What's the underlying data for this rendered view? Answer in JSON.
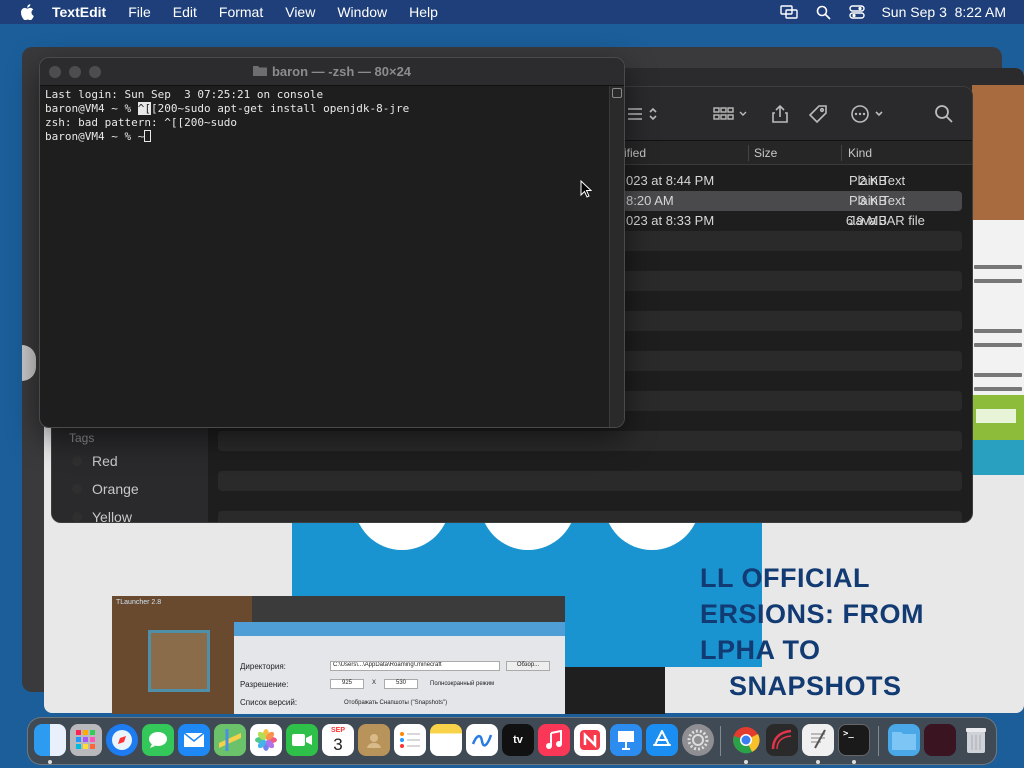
{
  "menubar": {
    "app_name": "TextEdit",
    "items": [
      "File",
      "Edit",
      "Format",
      "View",
      "Window",
      "Help"
    ],
    "clock": "Sun Sep 3  8:22 AM"
  },
  "terminal": {
    "title": "baron — -zsh — 80×24",
    "line1": "Last login: Sun Sep  3 07:25:21 on console",
    "line2_prompt": "baron@VM4 ~ % ",
    "line2_highlight": "^[",
    "line2_rest": "[200~sudo apt-get install openjdk-8-jre",
    "line3": "zsh: bad pattern: ^[[200~sudo",
    "line4_prompt": "baron@VM4 ~ % ~"
  },
  "finder": {
    "columns": {
      "modified": "ified",
      "size": "Size",
      "kind": "Kind"
    },
    "rows": [
      {
        "modified": "023 at 8:44 PM",
        "size": "2 KB",
        "kind": "Plain Text"
      },
      {
        "modified": "8:20 AM",
        "size": "3 KB",
        "kind": "Plain Text"
      },
      {
        "modified": "023 at 8:33 PM",
        "size": "6.9 MB",
        "kind": "Java JAR file"
      }
    ],
    "tags_title": "Tags",
    "tags": [
      "Red",
      "Orange",
      "Yellow"
    ]
  },
  "web": {
    "promo_lines": [
      "LL OFFICIAL",
      "ERSIONS: FROM",
      "LPHA TO",
      "SNAPSHOTS"
    ],
    "launcher": {
      "title": "TLauncher 2.8",
      "dir_label": "Директория:",
      "dir_value": "C:\\Users\\...\\AppData\\Roaming\\.minecraft",
      "browse": "Обзор...",
      "res_label": "Разрешение:",
      "res_w": "925",
      "res_x": "X",
      "res_h": "530",
      "fullscreen": "Полноэкранный режим",
      "versions_label": "Список версий:",
      "snapshots": "Отображать Снапшоты (\"Snapshots\")"
    }
  },
  "dock": {
    "calendar_month": "SEP",
    "calendar_day": "3",
    "tv_label": "tv",
    "terminal_glyph": ">_"
  },
  "colors": {
    "menubar": "#1e3f7a",
    "desktop": "#1b5e9a",
    "terminal_bg": "#1e1e1e",
    "promo_text": "#123a73",
    "blue_block": "#1a94d0"
  }
}
